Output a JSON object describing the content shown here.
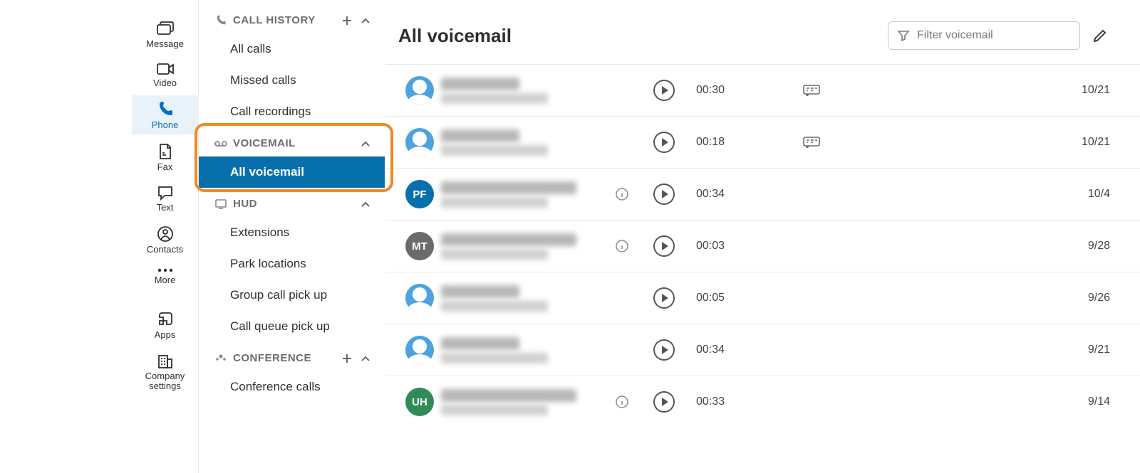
{
  "nav": {
    "items": [
      {
        "label": "Message"
      },
      {
        "label": "Video"
      },
      {
        "label": "Phone"
      },
      {
        "label": "Fax"
      },
      {
        "label": "Text"
      },
      {
        "label": "Contacts"
      },
      {
        "label": "More"
      },
      {
        "label": "Apps"
      },
      {
        "label": "Company settings"
      }
    ],
    "active_index": 2
  },
  "subnav": {
    "call_history": {
      "title": "CALL HISTORY",
      "items": [
        "All calls",
        "Missed calls",
        "Call recordings"
      ]
    },
    "voicemail": {
      "title": "VOICEMAIL",
      "items": [
        "All voicemail"
      ],
      "selected_index": 0
    },
    "hud": {
      "title": "HUD",
      "items": [
        "Extensions",
        "Park locations",
        "Group call pick up",
        "Call queue pick up"
      ]
    },
    "conference": {
      "title": "CONFERENCE",
      "items": [
        "Conference calls"
      ]
    }
  },
  "main": {
    "title": "All voicemail",
    "filter_placeholder": "Filter voicemail"
  },
  "voicemails": [
    {
      "avatar_type": "person",
      "initials": "",
      "avatar_color": "#4da3dd",
      "name": "Unknown",
      "number": "(800) 301-1844",
      "duration": "00:30",
      "has_transcript": true,
      "has_info": false,
      "date": "10/21"
    },
    {
      "avatar_type": "person",
      "initials": "",
      "avatar_color": "#4da3dd",
      "name": "Unknown",
      "number": "(855) 345-2710",
      "duration": "00:18",
      "has_transcript": true,
      "has_info": false,
      "date": "10/21"
    },
    {
      "avatar_type": "initials",
      "initials": "PF",
      "avatar_color": "#066fac",
      "name": "PROBABLY FRAUD",
      "number": "(409) 287-8308",
      "duration": "00:34",
      "has_transcript": false,
      "has_info": true,
      "date": "10/4"
    },
    {
      "avatar_type": "initials",
      "initials": "MT",
      "avatar_color": "#6a6a6a",
      "name": "MAURICEVILLE TX",
      "number": "(409) 233-3693",
      "duration": "00:03",
      "has_transcript": false,
      "has_info": true,
      "date": "9/28"
    },
    {
      "avatar_type": "person",
      "initials": "",
      "avatar_color": "#4da3dd",
      "name": "Unknown",
      "number": "(409) 247-0522",
      "duration": "00:05",
      "has_transcript": false,
      "has_info": false,
      "date": "9/26"
    },
    {
      "avatar_type": "person",
      "initials": "",
      "avatar_color": "#4da3dd",
      "name": "Unknown",
      "number": "(409) 290-2869",
      "duration": "00:34",
      "has_transcript": false,
      "has_info": false,
      "date": "9/21"
    },
    {
      "avatar_type": "initials",
      "initials": "UH",
      "avatar_color": "#2f8b57",
      "name": "UTMB HEALTH",
      "number": "(409) 266-5192",
      "duration": "00:33",
      "has_transcript": false,
      "has_info": true,
      "date": "9/14"
    }
  ]
}
